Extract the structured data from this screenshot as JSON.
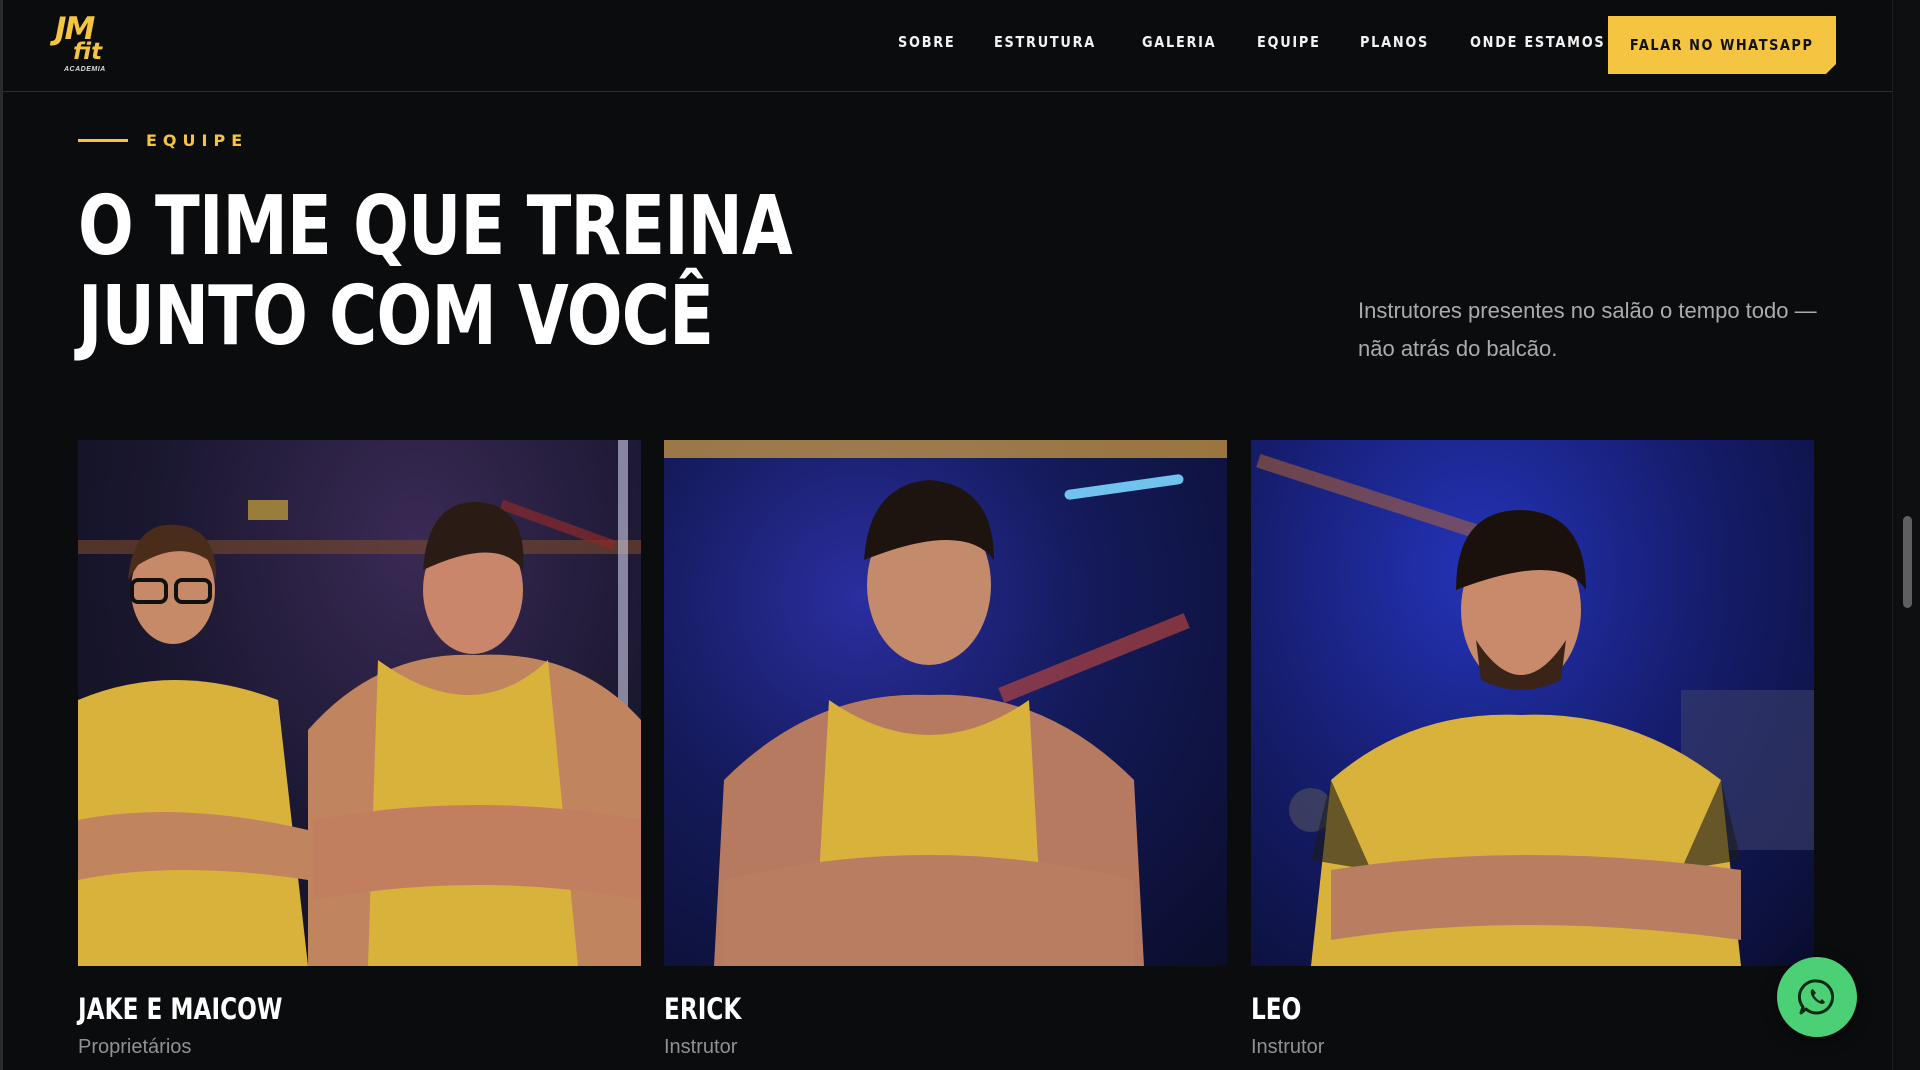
{
  "brand": {
    "logo_main": "JM",
    "logo_fit": "fit",
    "logo_sub": "ACADEMIA",
    "accent": "#f5c542"
  },
  "nav": {
    "items": [
      "SOBRE",
      "ESTRUTURA",
      "GALERIA",
      "EQUIPE",
      "PLANOS",
      "ONDE ESTAMOS"
    ],
    "cta": "FALAR NO WHATSAPP"
  },
  "section": {
    "eyebrow": "EQUIPE",
    "title_line1": "O TIME QUE TREINA",
    "title_line2": "JUNTO COM VOCÊ",
    "subtitle": "Instrutores presentes no salão o tempo todo — não atrás do balcão."
  },
  "team": [
    {
      "name": "JAKE E MAICOW",
      "role": "Proprietários"
    },
    {
      "name": "ERICK",
      "role": "Instrutor"
    },
    {
      "name": "LEO",
      "role": "Instrutor"
    }
  ],
  "floating": {
    "icon": "whatsapp-icon"
  }
}
